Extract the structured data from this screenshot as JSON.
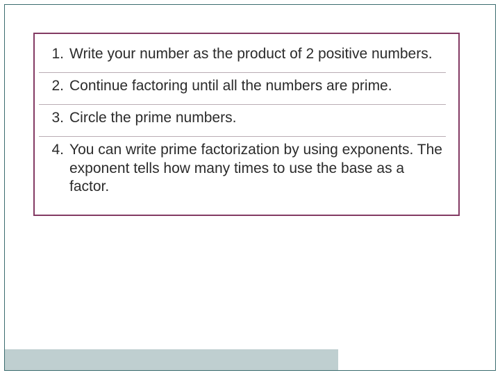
{
  "steps": [
    {
      "n": "1.",
      "text": "Write your number as the product of 2 positive numbers."
    },
    {
      "n": "2.",
      "text": "Continue factoring until all the numbers are prime."
    },
    {
      "n": "3.",
      "text": "Circle the prime numbers."
    },
    {
      "n": "4.",
      "text": "You can write prime factorization by using exponents. The exponent tells how many times to use the base as a factor."
    }
  ]
}
